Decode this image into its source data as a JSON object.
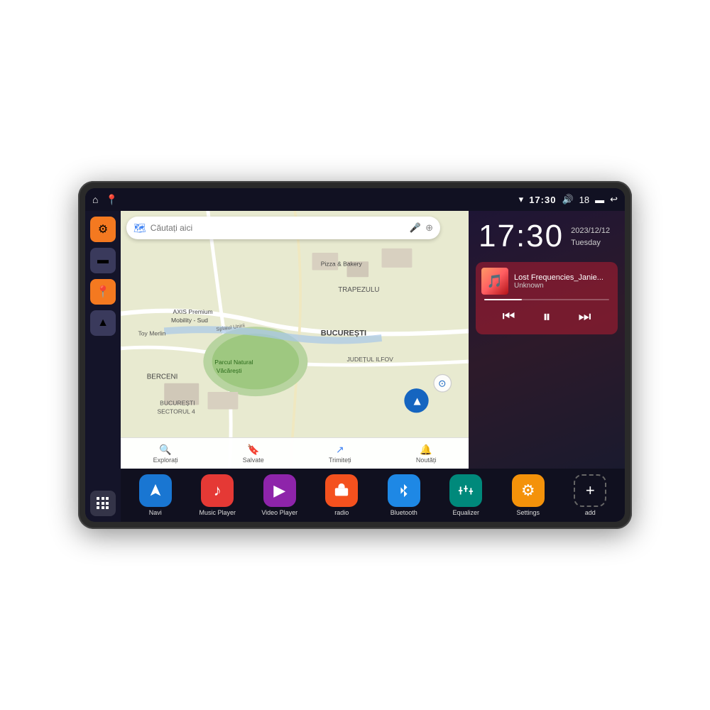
{
  "statusBar": {
    "leftIcons": [
      "⌂",
      "📍"
    ],
    "rightContent": {
      "wifi": "▾",
      "time": "17:30",
      "volume": "🔊",
      "battery_num": "18",
      "battery": "🔋",
      "back": "↩"
    }
  },
  "sidebar": {
    "buttons": [
      {
        "id": "settings",
        "icon": "⚙",
        "color": "orange"
      },
      {
        "id": "files",
        "icon": "📁",
        "color": "dark"
      },
      {
        "id": "map",
        "icon": "📍",
        "color": "orange"
      },
      {
        "id": "nav",
        "icon": "▲",
        "color": "dark"
      }
    ]
  },
  "map": {
    "searchPlaceholder": "Căutați aici",
    "navItems": [
      {
        "icon": "🔍",
        "label": "Explorați"
      },
      {
        "icon": "🔖",
        "label": "Salvate"
      },
      {
        "icon": "↗",
        "label": "Trimiteți"
      },
      {
        "icon": "🔔",
        "label": "Noutăți"
      }
    ],
    "places": [
      "AXIS Premium Mobility - Sud",
      "Pizza & Bakery",
      "Parcul Natural Văcărești",
      "TRAPEZULU",
      "BUCUREȘTI",
      "JUDEȚUL ILFOV",
      "BUCUREȘTI SECTORUL 4",
      "BERCENI",
      "Toy Merlin"
    ]
  },
  "clock": {
    "time": "17:30",
    "date": "2023/12/12",
    "day": "Tuesday"
  },
  "music": {
    "title": "Lost Frequencies_Janie...",
    "artist": "Unknown",
    "controls": {
      "prev": "⏮",
      "play": "⏸",
      "next": "⏭"
    }
  },
  "apps": [
    {
      "id": "navi",
      "label": "Navi",
      "icon": "▲",
      "color": "bg-blue"
    },
    {
      "id": "music-player",
      "label": "Music Player",
      "icon": "♪",
      "color": "bg-red"
    },
    {
      "id": "video-player",
      "label": "Video Player",
      "icon": "▶",
      "color": "bg-purple"
    },
    {
      "id": "radio",
      "label": "radio",
      "icon": "📻",
      "color": "bg-orange"
    },
    {
      "id": "bluetooth",
      "label": "Bluetooth",
      "icon": "✦",
      "color": "bg-blue2"
    },
    {
      "id": "equalizer",
      "label": "Equalizer",
      "icon": "🎚",
      "color": "bg-teal"
    },
    {
      "id": "settings",
      "label": "Settings",
      "icon": "⚙",
      "color": "bg-amber"
    },
    {
      "id": "add",
      "label": "add",
      "icon": "+",
      "color": "bg-grid"
    }
  ]
}
